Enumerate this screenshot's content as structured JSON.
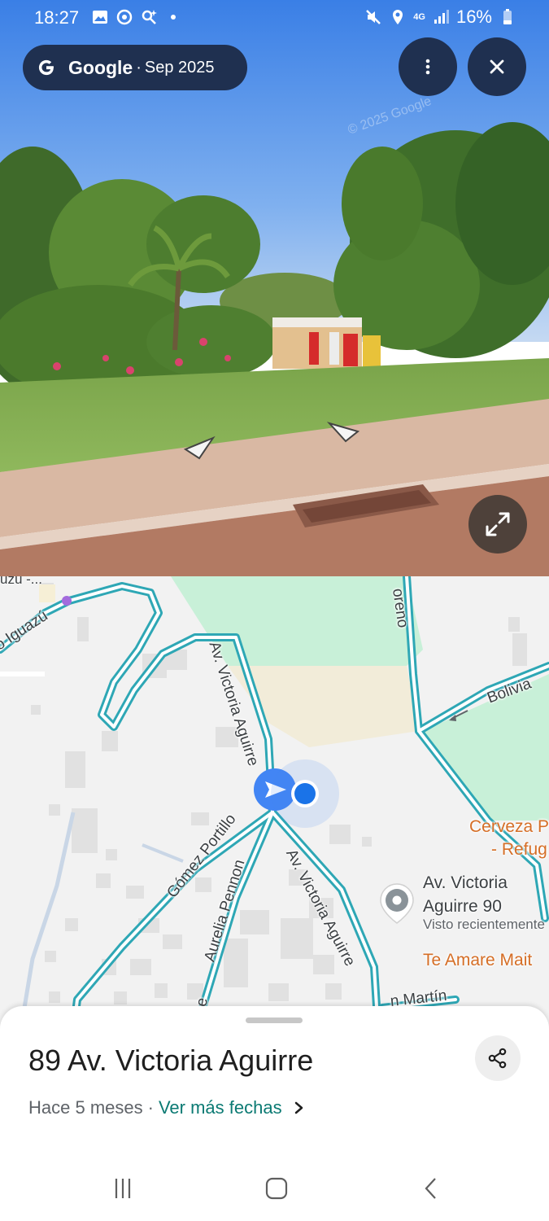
{
  "status_bar": {
    "time": "18:27",
    "battery": "16%",
    "network": "4G"
  },
  "source": {
    "provider": "Google",
    "separator": "·",
    "date": "Sep 2025"
  },
  "watermark": "© 2025 Google",
  "map": {
    "labels": {
      "iguazu": "o Iguazú",
      "iguazu_top": "uzú -...",
      "av_victoria_upper": "Av. Victoria Aguirre",
      "av_victoria_lower": "Av. Victoria Aguirre",
      "gomez_portillo": "Gómez Portillo",
      "aurelia_pennon": "Aurelia Pennon",
      "moreno": "oreno",
      "bolivia": "Bolivia",
      "san_martin": "n Martín",
      "s_street": "Se"
    },
    "poi": {
      "name": "Av. Victoria Aguirre 90",
      "subtitle": "Visto recientemente"
    },
    "places": {
      "cerveza_line1": "Cerveza P",
      "cerveza_line2": "- Refug",
      "te_amare": "Te Amare Mait"
    },
    "colors": {
      "road": "#2ea7b5",
      "park": "#c8f0d8",
      "sand": "#f2ecd9",
      "background": "#f2f2f2",
      "location": "#1a73e8"
    }
  },
  "sheet": {
    "title": "89 Av. Victoria Aguirre",
    "age": "Hace 5 meses",
    "separator": "·",
    "more_dates": "Ver más fechas"
  }
}
